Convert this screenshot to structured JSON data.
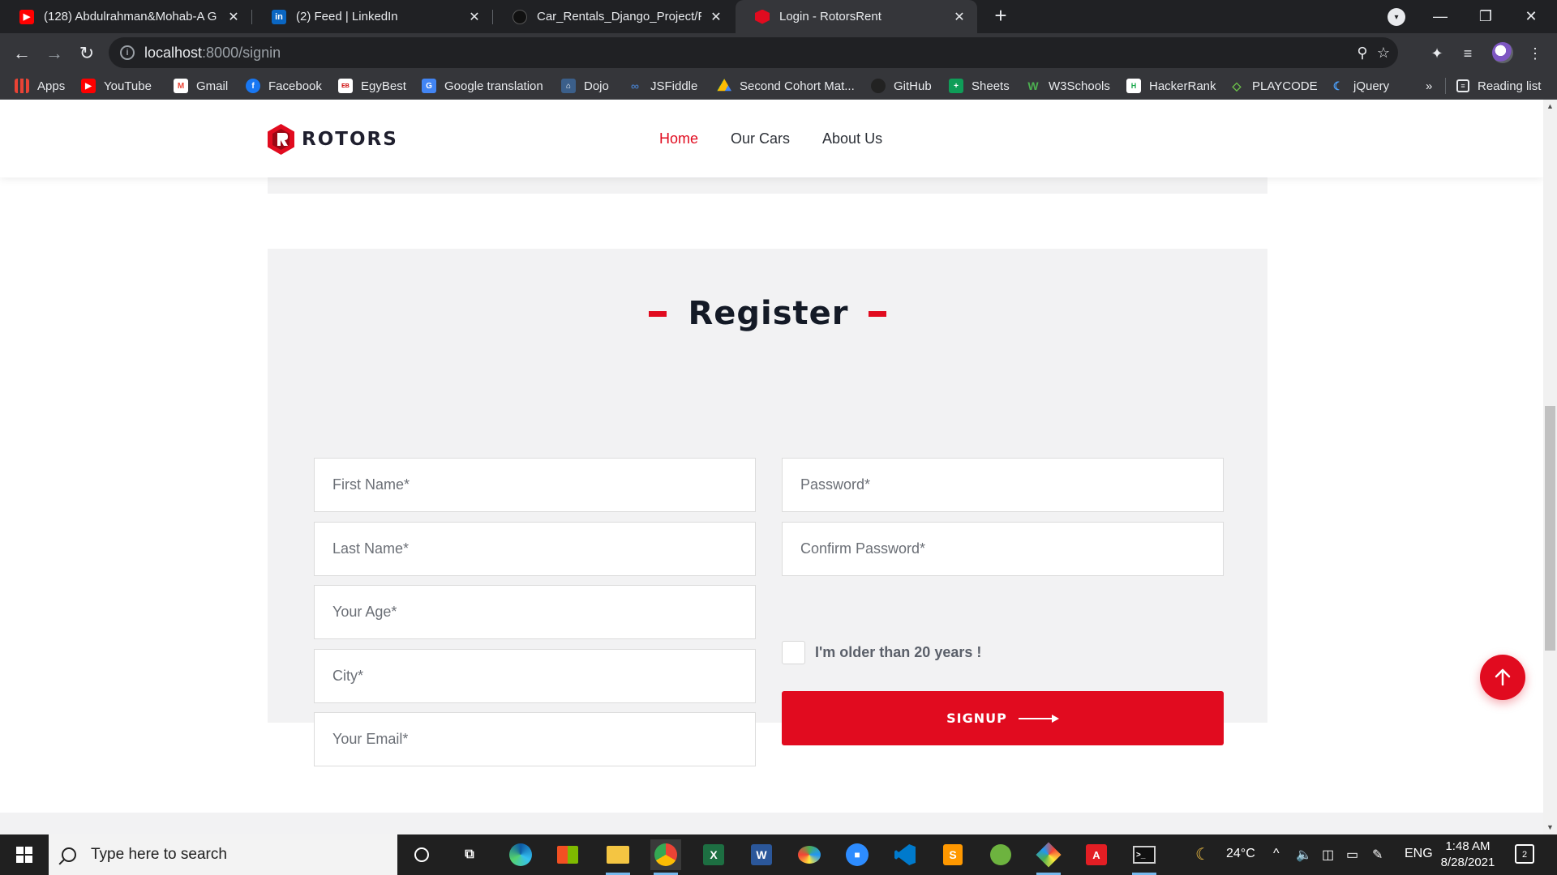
{
  "browser": {
    "tabs": [
      {
        "title": "(128) Abdulrahman&Mohab-A G",
        "icon": "youtube-icon"
      },
      {
        "title": "(2) Feed | LinkedIn",
        "icon": "linkedin-icon"
      },
      {
        "title": "Car_Rentals_Django_Project/REA",
        "icon": "github-icon"
      },
      {
        "title": "Login - RotorsRent",
        "icon": "rotors-icon"
      }
    ],
    "url_host": "localhost",
    "url_path": ":8000/signin",
    "bookmarks": [
      {
        "label": "Apps",
        "icon": "apps-grid-icon"
      },
      {
        "label": "YouTube",
        "icon": "youtube-icon"
      },
      {
        "label": "Gmail",
        "icon": "gmail-icon"
      },
      {
        "label": "Facebook",
        "icon": "facebook-icon"
      },
      {
        "label": "EgyBest",
        "icon": "egybest-icon"
      },
      {
        "label": "Google translation",
        "icon": "google-translate-icon"
      },
      {
        "label": "Dojo",
        "icon": "dojo-icon"
      },
      {
        "label": "JSFiddle",
        "icon": "jsfiddle-icon"
      },
      {
        "label": "Second Cohort Mat...",
        "icon": "google-drive-icon"
      },
      {
        "label": "GitHub",
        "icon": "github-icon"
      },
      {
        "label": "Sheets",
        "icon": "sheets-icon"
      },
      {
        "label": "W3Schools",
        "icon": "w3schools-icon"
      },
      {
        "label": "HackerRank",
        "icon": "hackerrank-icon"
      },
      {
        "label": "PLAYCODE",
        "icon": "playcode-icon"
      },
      {
        "label": "jQuery",
        "icon": "jquery-icon"
      }
    ],
    "bookmarks_overflow": "»",
    "reading_list": "Reading list"
  },
  "site": {
    "logo_text": "ROTORS",
    "nav": [
      {
        "label": "Home",
        "active": true
      },
      {
        "label": "Our Cars",
        "active": false
      },
      {
        "label": "About Us",
        "active": false
      }
    ],
    "brand_color": "#e10b1f"
  },
  "register": {
    "title": "Register",
    "fields_left": [
      {
        "placeholder": "First Name*",
        "value": ""
      },
      {
        "placeholder": "Last Name*",
        "value": ""
      },
      {
        "placeholder": "Your Age*",
        "value": ""
      },
      {
        "placeholder": "City*",
        "value": ""
      },
      {
        "placeholder": "Your Email*",
        "value": ""
      }
    ],
    "fields_right": [
      {
        "placeholder": "Password*",
        "value": ""
      },
      {
        "placeholder": "Confirm Password*",
        "value": ""
      }
    ],
    "age_check_label": "I'm older than 20 years !",
    "age_checked": false,
    "signup_label": "SIGNUP"
  },
  "taskbar": {
    "search_placeholder": "Type here to search",
    "weather": "24°C",
    "language": "ENG",
    "time": "1:48 AM",
    "date": "8/28/2021",
    "notification_count": "2"
  }
}
